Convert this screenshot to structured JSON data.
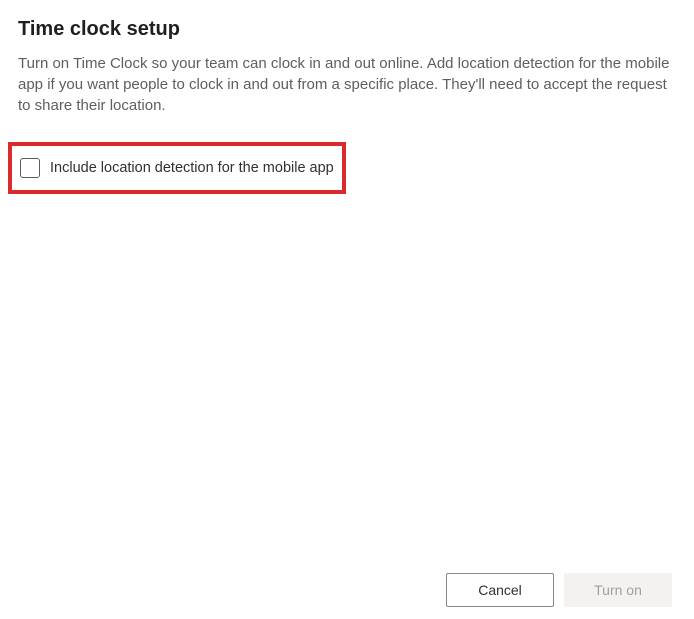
{
  "dialog": {
    "title": "Time clock setup",
    "description": "Turn on Time Clock so your team can clock in and out online. Add location detection for the mobile app if you want people to clock in and out from a specific place. They'll need to accept the request to share their location.",
    "checkbox_label": "Include location detection for the mobile app",
    "buttons": {
      "cancel": "Cancel",
      "confirm": "Turn on"
    }
  }
}
